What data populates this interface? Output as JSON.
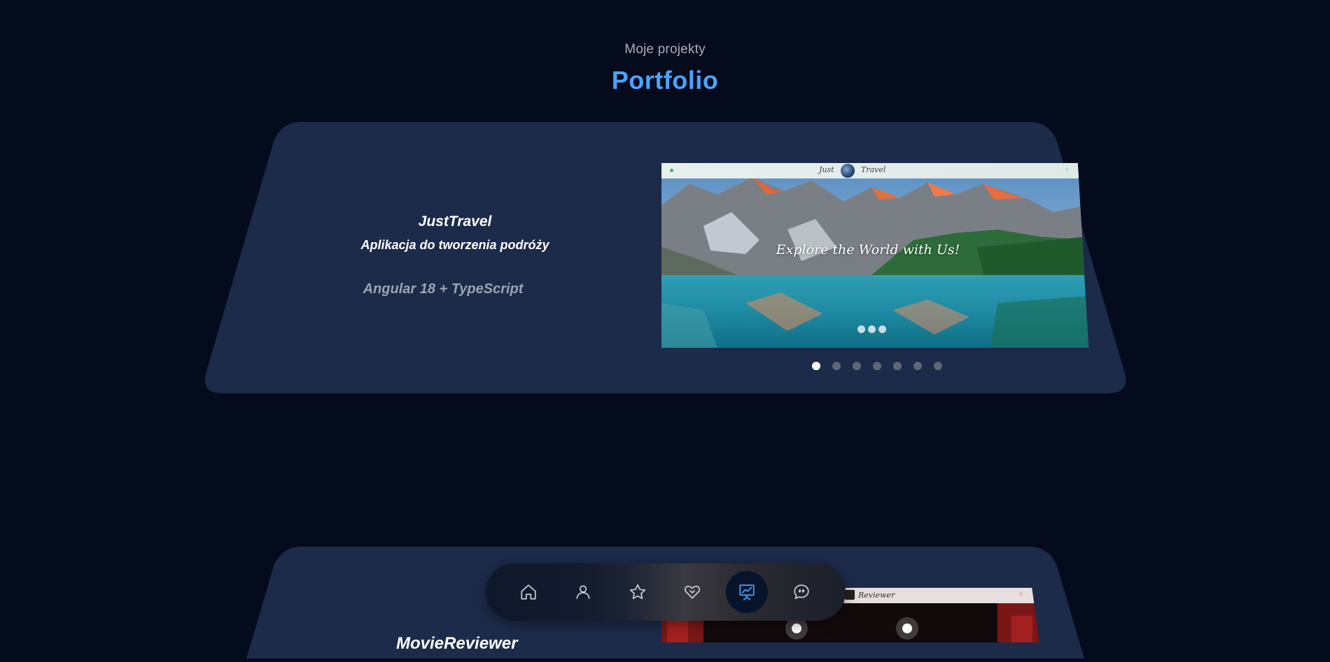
{
  "section": {
    "subtitle": "Moje projekty",
    "title": "Portfolio"
  },
  "projects": [
    {
      "name": "JustTravel",
      "description": "Aplikacja do tworzenia podróży",
      "tech": "Angular 18 + TypeScript",
      "screenshot": {
        "logo_left": "Just",
        "logo_right": "Travel",
        "caption": "Explore the World with Us!"
      },
      "carousel": {
        "count": 7,
        "active_index": 0
      }
    },
    {
      "name": "MovieReviewer",
      "screenshot": {
        "logo": "Reviewer"
      }
    }
  ],
  "nav": {
    "items": [
      {
        "icon": "home-icon",
        "label": "home"
      },
      {
        "icon": "user-icon",
        "label": "about"
      },
      {
        "icon": "star-icon",
        "label": "skills"
      },
      {
        "icon": "heart-handshake-icon",
        "label": "services"
      },
      {
        "icon": "presentation-chart-icon",
        "label": "portfolio",
        "active": true
      },
      {
        "icon": "chat-bubbles-icon",
        "label": "contact"
      }
    ],
    "active_color": "#4ba3ff",
    "icon_color": "#c9ccd3"
  },
  "colors": {
    "background": "#040b1c",
    "card": "#1c2b4a",
    "accent": "#4ba3ff"
  }
}
